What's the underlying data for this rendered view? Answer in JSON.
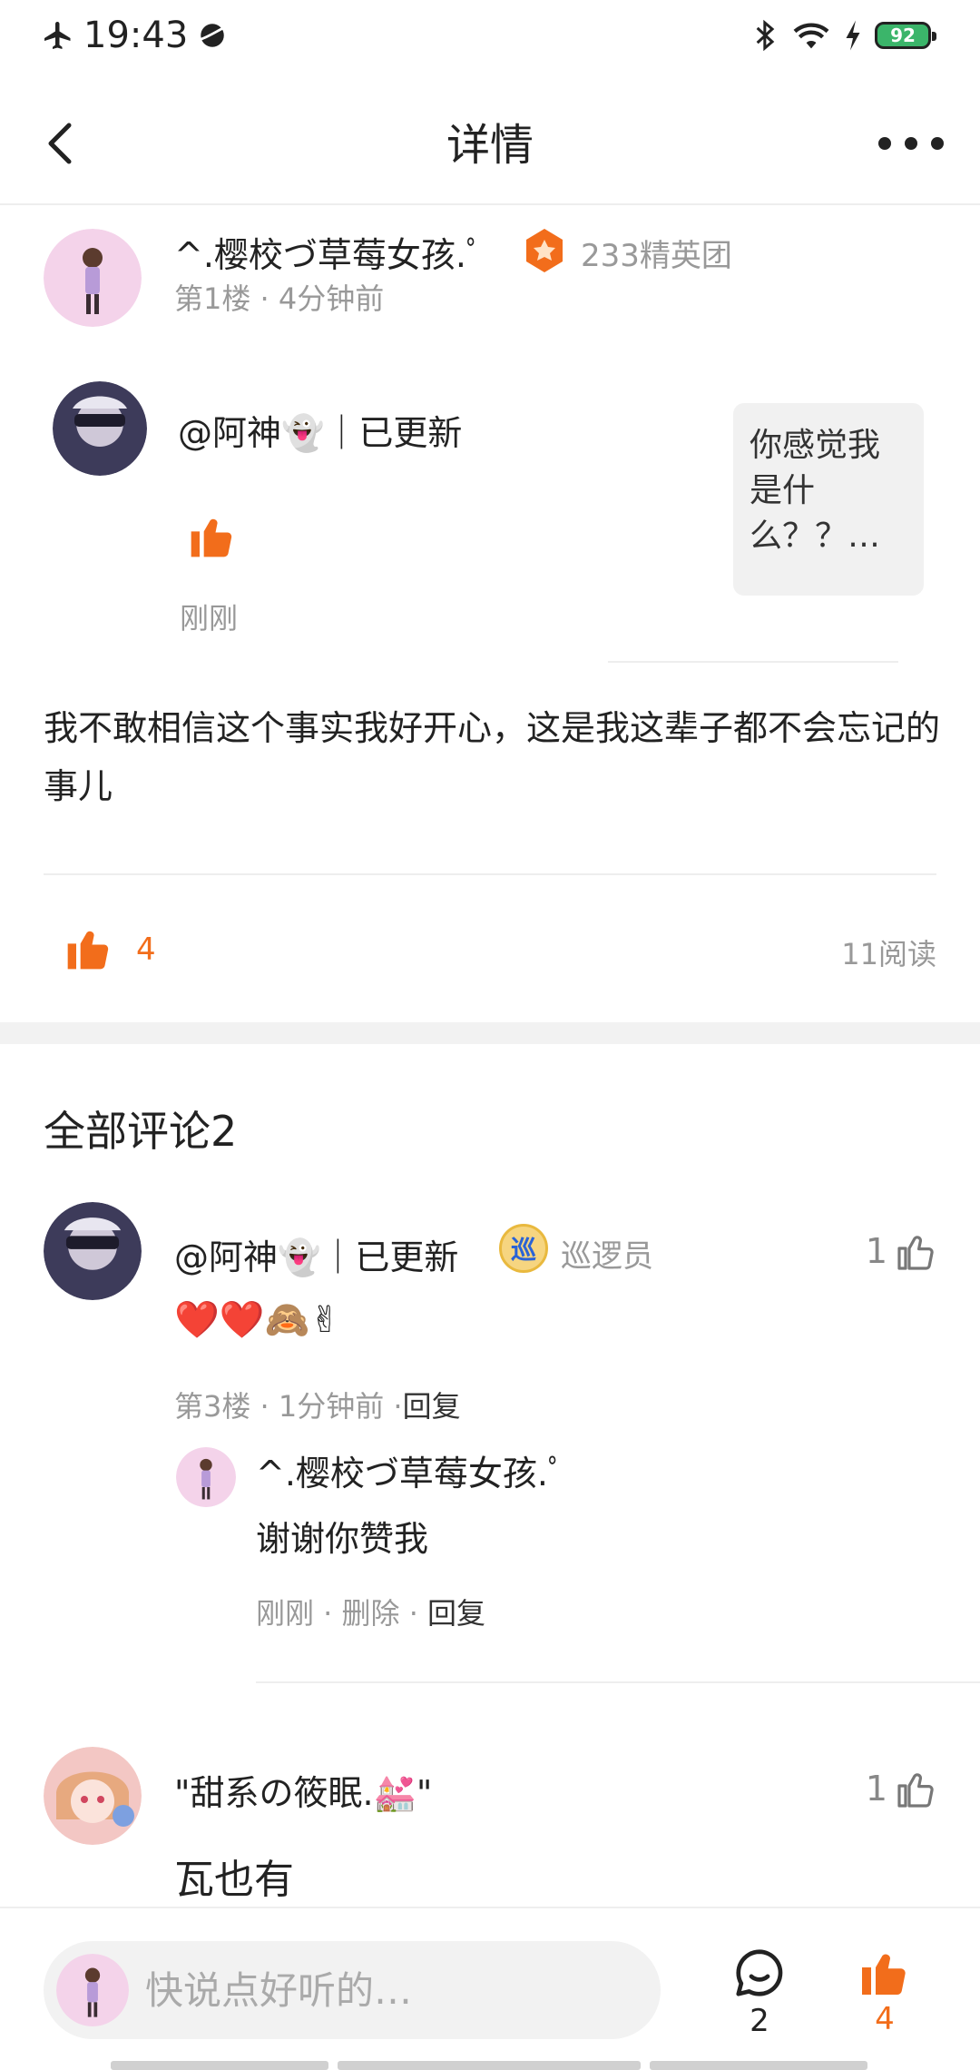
{
  "status_bar": {
    "time": "19:43",
    "battery": "92"
  },
  "nav": {
    "title": "详情"
  },
  "post": {
    "author": "^.樱校づ草莓女孩.ﾟ",
    "group": "233精英团",
    "meta": "第1楼 · 4分钟前",
    "quote": {
      "user": "@阿神👻｜已更新",
      "time": "刚刚",
      "text": "你感觉我是什么？？…"
    },
    "body": "我不敢相信这个事实我好开心，这是我这辈子都不会忘记的事儿",
    "like_count": "4",
    "read_count": "11阅读"
  },
  "comments_title": "全部评论2",
  "comments": [
    {
      "name": "@阿神👻｜已更新",
      "badge_glyph": "巡",
      "badge_label": "巡逻员",
      "likes": "1",
      "content": "❤️❤️🙈✌",
      "meta_prefix": "第3楼 · 1分钟前 ·",
      "reply_label": "回复",
      "reply": {
        "name": "^.樱校づ草莓女孩.ﾟ",
        "text": "谢谢你赞我",
        "meta_prefix": "刚刚 · 删除 · ",
        "reply_label": "回复"
      }
    },
    {
      "name": "\"甜系の筱眠.💒\"",
      "likes": "1",
      "content": "瓦也有"
    }
  ],
  "bottom": {
    "input_placeholder": "快说点好听的…",
    "comment_count": "2",
    "like_count": "4"
  },
  "colors": {
    "accent": "#f26d1b",
    "muted": "#999999",
    "divider": "#eeeeee"
  }
}
